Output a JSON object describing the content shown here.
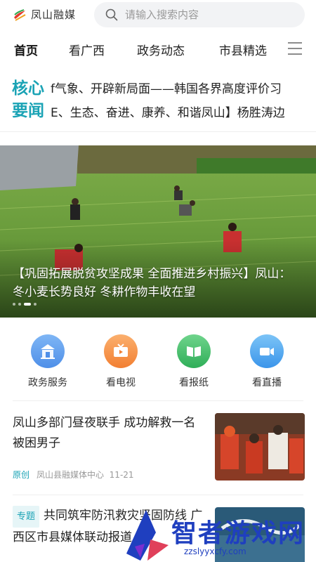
{
  "header": {
    "app_name": "凤山融媒",
    "search_placeholder": "请输入搜索内容"
  },
  "tabs": [
    {
      "label": "首页",
      "active": true
    },
    {
      "label": "看广西",
      "active": false
    },
    {
      "label": "政务动态",
      "active": false
    },
    {
      "label": "市县精选",
      "active": false
    }
  ],
  "ticker": {
    "badge": "核心要闻",
    "lines": [
      "f气象、开辟新局面——韩国各界高度评价习",
      "E、生态、奋进、康养、和谐凤山】杨胜涛边"
    ]
  },
  "hero": {
    "caption": "【巩固拓展脱贫攻坚成果 全面推进乡村振兴】凤山：冬小麦长势良好 冬耕作物丰收在望",
    "dot_count": 4,
    "active_dot": 2
  },
  "quick_access": [
    {
      "label": "政务服务",
      "icon": "building-icon",
      "color": "#5b9ff2"
    },
    {
      "label": "看电视",
      "icon": "tv-icon",
      "color": "#f7944a"
    },
    {
      "label": "看报纸",
      "icon": "newspaper-icon",
      "color": "#3fbf6a"
    },
    {
      "label": "看直播",
      "icon": "camera-icon",
      "color": "#4aa8f0"
    }
  ],
  "news": [
    {
      "title": "凤山多部门昼夜联手 成功解救一名被困男子",
      "tag": "原创",
      "source": "凤山县融媒体中心",
      "date": "11-21"
    },
    {
      "chip": "专题",
      "title": "共同筑牢防汛救灾坚固防线 广西区市县媒体联动报道"
    }
  ],
  "watermark": {
    "text": "智者游戏网",
    "url": "zzslyyxcfy.com"
  },
  "colors": {
    "accent": "#1aa3b5",
    "watermark": "#1f3fbf"
  }
}
